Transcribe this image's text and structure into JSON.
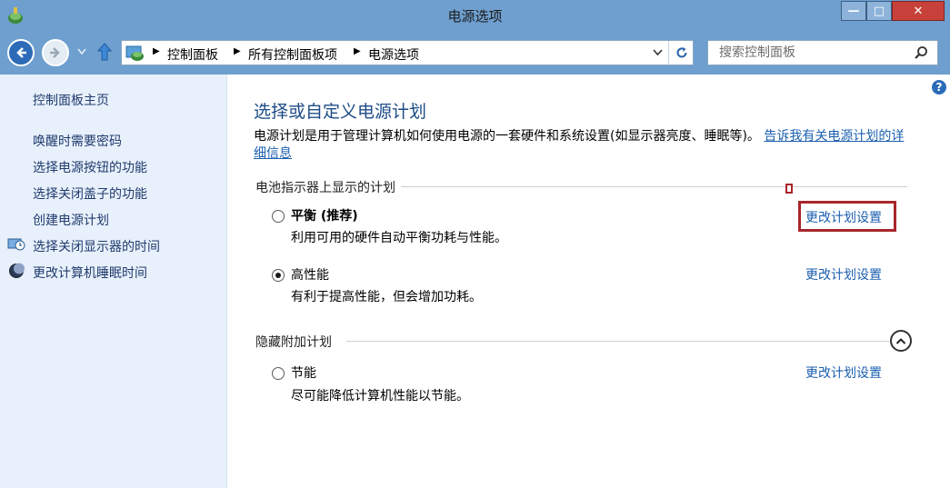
{
  "window": {
    "title": "电源选项",
    "minimize_label": "—",
    "maximize_label": "□",
    "close_label": "✕"
  },
  "address_bar": {
    "breadcrumbs": [
      "控制面板",
      "所有控制面板项",
      "电源选项"
    ]
  },
  "search": {
    "placeholder": "搜索控制面板"
  },
  "sidebar": {
    "items": [
      {
        "label": "控制面板主页"
      },
      {
        "label": "唤醒时需要密码"
      },
      {
        "label": "选择电源按钮的功能"
      },
      {
        "label": "选择关闭盖子的功能"
      },
      {
        "label": "创建电源计划"
      },
      {
        "label": "选择关闭显示器的时间",
        "icon": "monitor-clock-icon"
      },
      {
        "label": "更改计算机睡眠时间",
        "icon": "moon-icon"
      }
    ]
  },
  "main": {
    "help_label": "?",
    "title": "选择或自定义电源计划",
    "description": "电源计划是用于管理计算机如何使用电源的一套硬件和系统设置(如显示器亮度、睡眠等)。",
    "description_link": "告诉我有关电源计划的详细信息",
    "battery_section": {
      "heading": "电池指示器上显示的计划",
      "plans": [
        {
          "name": "平衡 (推荐)",
          "description": "利用可用的硬件自动平衡功耗与性能。",
          "selected": false,
          "link": "更改计划设置"
        },
        {
          "name": "高性能",
          "description": "有利于提高性能，但会增加功耗。",
          "selected": true,
          "link": "更改计划设置"
        }
      ]
    },
    "hidden_section": {
      "heading": "隐藏附加计划",
      "plans": [
        {
          "name": "节能",
          "description": "尽可能降低计算机性能以节能。",
          "selected": false,
          "link": "更改计划设置"
        }
      ]
    }
  },
  "colors": {
    "title_bar": "#6e9fcf",
    "sidebar_bg": "#e8f0fb",
    "link": "#1b5faf",
    "heading": "#1d4c86",
    "highlight": "#a8262b"
  }
}
